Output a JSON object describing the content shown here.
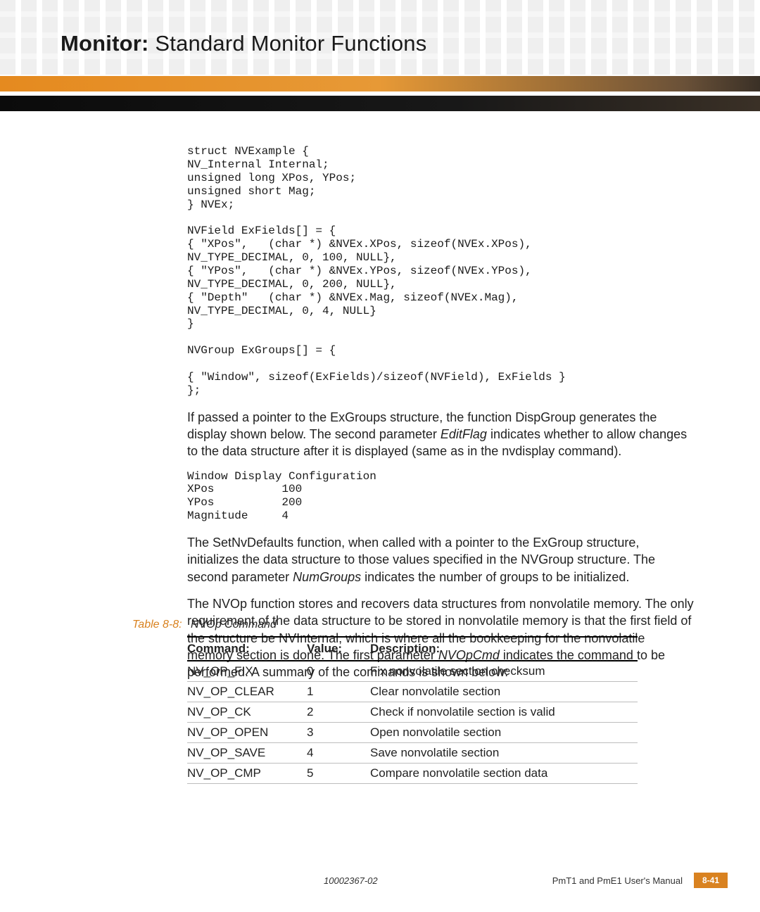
{
  "header": {
    "title_bold": "Monitor:",
    "title_light": "Standard Monitor Functions"
  },
  "code_block_1": "struct NVExample {\nNV_Internal Internal;\nunsigned long XPos, YPos;\nunsigned short Mag;\n} NVEx;\n\nNVField ExFields[] = {\n{ \"XPos\",   (char *) &NVEx.XPos, sizeof(NVEx.XPos),\nNV_TYPE_DECIMAL, 0, 100, NULL},\n{ \"YPos\",   (char *) &NVEx.YPos, sizeof(NVEx.YPos),\nNV_TYPE_DECIMAL, 0, 200, NULL},\n{ \"Depth\"   (char *) &NVEx.Mag, sizeof(NVEx.Mag),\nNV_TYPE_DECIMAL, 0, 4, NULL}\n}\n\nNVGroup ExGroups[] = {\n\n{ \"Window\", sizeof(ExFields)/sizeof(NVField), ExFields }\n};",
  "para_1_a": "If passed a pointer to the ExGroups structure, the function ",
  "para_1_fn1": "DispGroup",
  "para_1_b": " generates the display shown below. The second parameter ",
  "para_1_it1": "EditFlag",
  "para_1_c": " indicates whether to allow changes to the data structure after it is displayed (same as in the ",
  "para_1_fn2": "nvdisplay",
  "para_1_d": " command).",
  "code_block_2": "Window Display Configuration\nXPos          100\nYPos          200\nMagnitude     4",
  "para_2_a": "The ",
  "para_2_fn": "SetNvDefaults",
  "para_2_b": " function, when called with a pointer to the ExGroup structure, initializes the data structure to those values specified in the NVGroup structure. The second parameter ",
  "para_2_it": "NumGroups",
  "para_2_c": " indicates the number of groups to be initialized.",
  "para_3_a": "The ",
  "para_3_fn": "NVOp",
  "para_3_b": " function stores and recovers data structures from nonvolatile memory. The only requirement of the data structure to be stored in nonvolatile memory is that the first field of the structure be NVInternal, which is where all the bookkeeping for the nonvolatile memory section is done. The first parameter ",
  "para_3_it": "NVOpCmd",
  "para_3_c": " indicates the command to be performed. A summary of the commands is shown below:",
  "table": {
    "caption_num": "Table 8-8:",
    "caption_name": "NVOp Command",
    "headers": {
      "c1": "Command:",
      "c2": "Value:",
      "c3": "Description:"
    },
    "rows": [
      {
        "cmd": "NV_OP_FIX",
        "val": "0",
        "desc": "Fix nonvolatile section checksum"
      },
      {
        "cmd": "NV_OP_CLEAR",
        "val": "1",
        "desc": "Clear nonvolatile section"
      },
      {
        "cmd": "NV_OP_CK",
        "val": "2",
        "desc": "Check if nonvolatile section is valid"
      },
      {
        "cmd": "NV_OP_OPEN",
        "val": "3",
        "desc": "Open nonvolatile section"
      },
      {
        "cmd": "NV_OP_SAVE",
        "val": "4",
        "desc": "Save nonvolatile section"
      },
      {
        "cmd": "NV_OP_CMP",
        "val": "5",
        "desc": "Compare nonvolatile section data"
      }
    ]
  },
  "footer": {
    "docnum": "10002367-02",
    "manual": "PmT1 and PmE1 User's Manual",
    "page": "8-41"
  }
}
